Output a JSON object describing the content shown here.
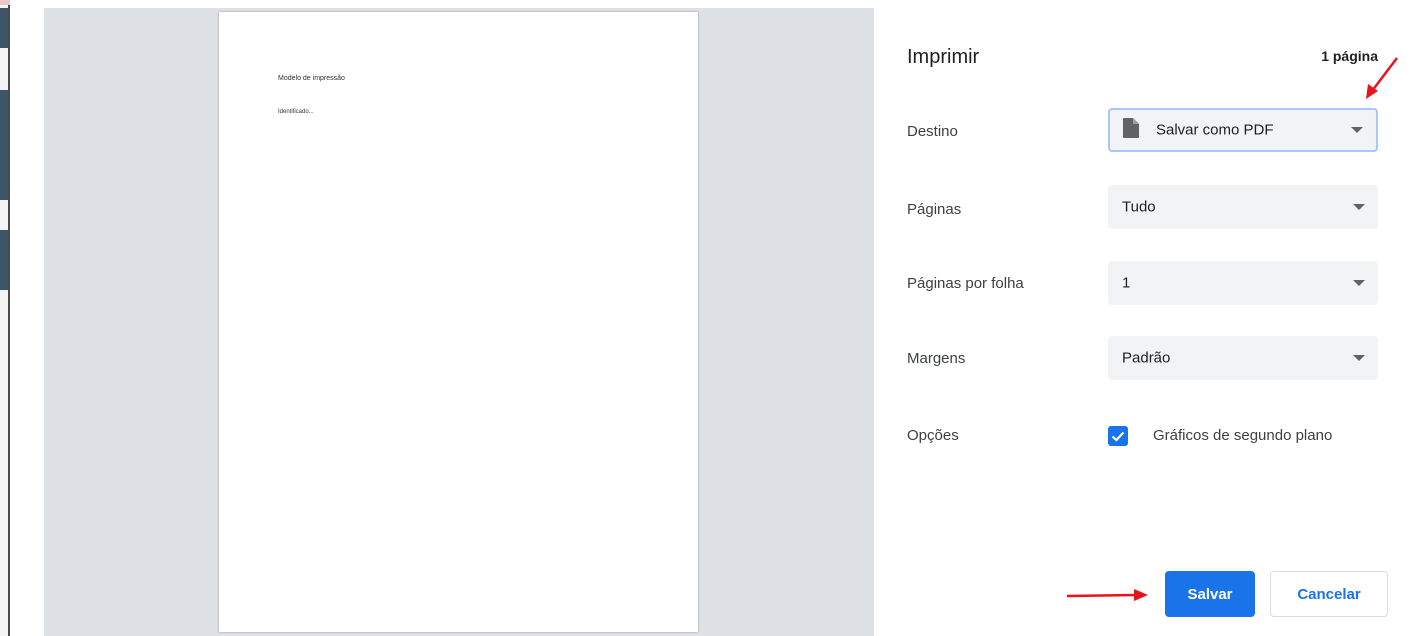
{
  "preview": {
    "paper_title": "Modelo de impressão",
    "paper_line": "Identificado..."
  },
  "settings": {
    "title": "Imprimir",
    "page_count": "1 página",
    "destination": {
      "label": "Destino",
      "value": "Salvar como PDF",
      "icon": "file-icon"
    },
    "pages": {
      "label": "Páginas",
      "value": "Tudo"
    },
    "pages_per_sheet": {
      "label": "Páginas por folha",
      "value": "1"
    },
    "margins": {
      "label": "Margens",
      "value": "Padrão"
    },
    "options": {
      "label": "Opções",
      "checkbox_label": "Gráficos de segundo plano",
      "checked": true
    }
  },
  "buttons": {
    "save": "Salvar",
    "cancel": "Cancelar"
  },
  "colors": {
    "accent": "#1a73e8",
    "annotation_arrow": "#e8141b",
    "preview_bg": "#dee1e6"
  }
}
